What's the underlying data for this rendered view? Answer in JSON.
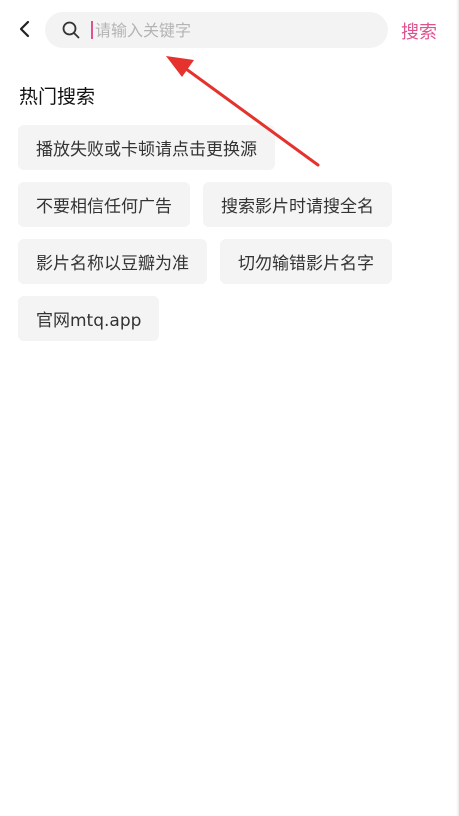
{
  "header": {
    "back_icon": "chevron-left-icon",
    "search_icon": "search-icon",
    "search_placeholder": "请输入关键字",
    "search_value": "",
    "search_button_label": "搜索"
  },
  "hot_search": {
    "title": "热门搜索",
    "tags": [
      "播放失败或卡顿请点击更换源",
      "不要相信任何广告",
      "搜索影片时请搜全名",
      "影片名称以豆瓣为准",
      "切勿输错影片名字",
      "官网mtq.app"
    ]
  },
  "colors": {
    "accent": "#e0528f",
    "tag_bg": "#f4f4f4",
    "search_bg": "#f3f3f3",
    "annotation_arrow": "#e5322d"
  }
}
